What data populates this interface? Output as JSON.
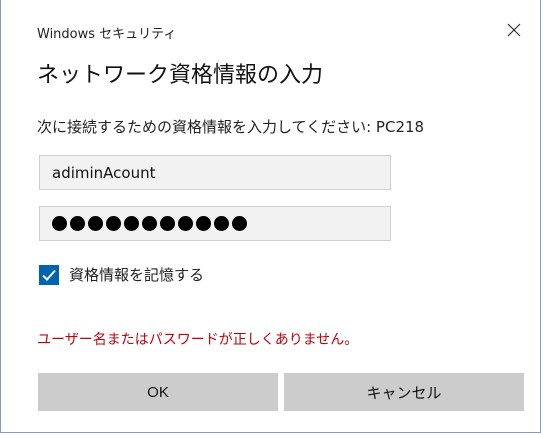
{
  "window": {
    "title": "Windows セキュリティ",
    "close_icon": "close-icon"
  },
  "dialog": {
    "heading": "ネットワーク資格情報の入力",
    "prompt": "次に接続するための資格情報を入力してください: PC218",
    "username_value": "adiminAcount",
    "password_masked_length": 11,
    "remember_label": "資格情報を記憶する",
    "remember_checked": true,
    "error_message": "ユーザー名またはパスワードが正しくありません。",
    "ok_label": "OK",
    "cancel_label": "キャンセル"
  },
  "colors": {
    "accent": "#0063b1",
    "error": "#c4000b",
    "button_bg": "#cccccc",
    "field_bg": "#f2f2f2"
  }
}
